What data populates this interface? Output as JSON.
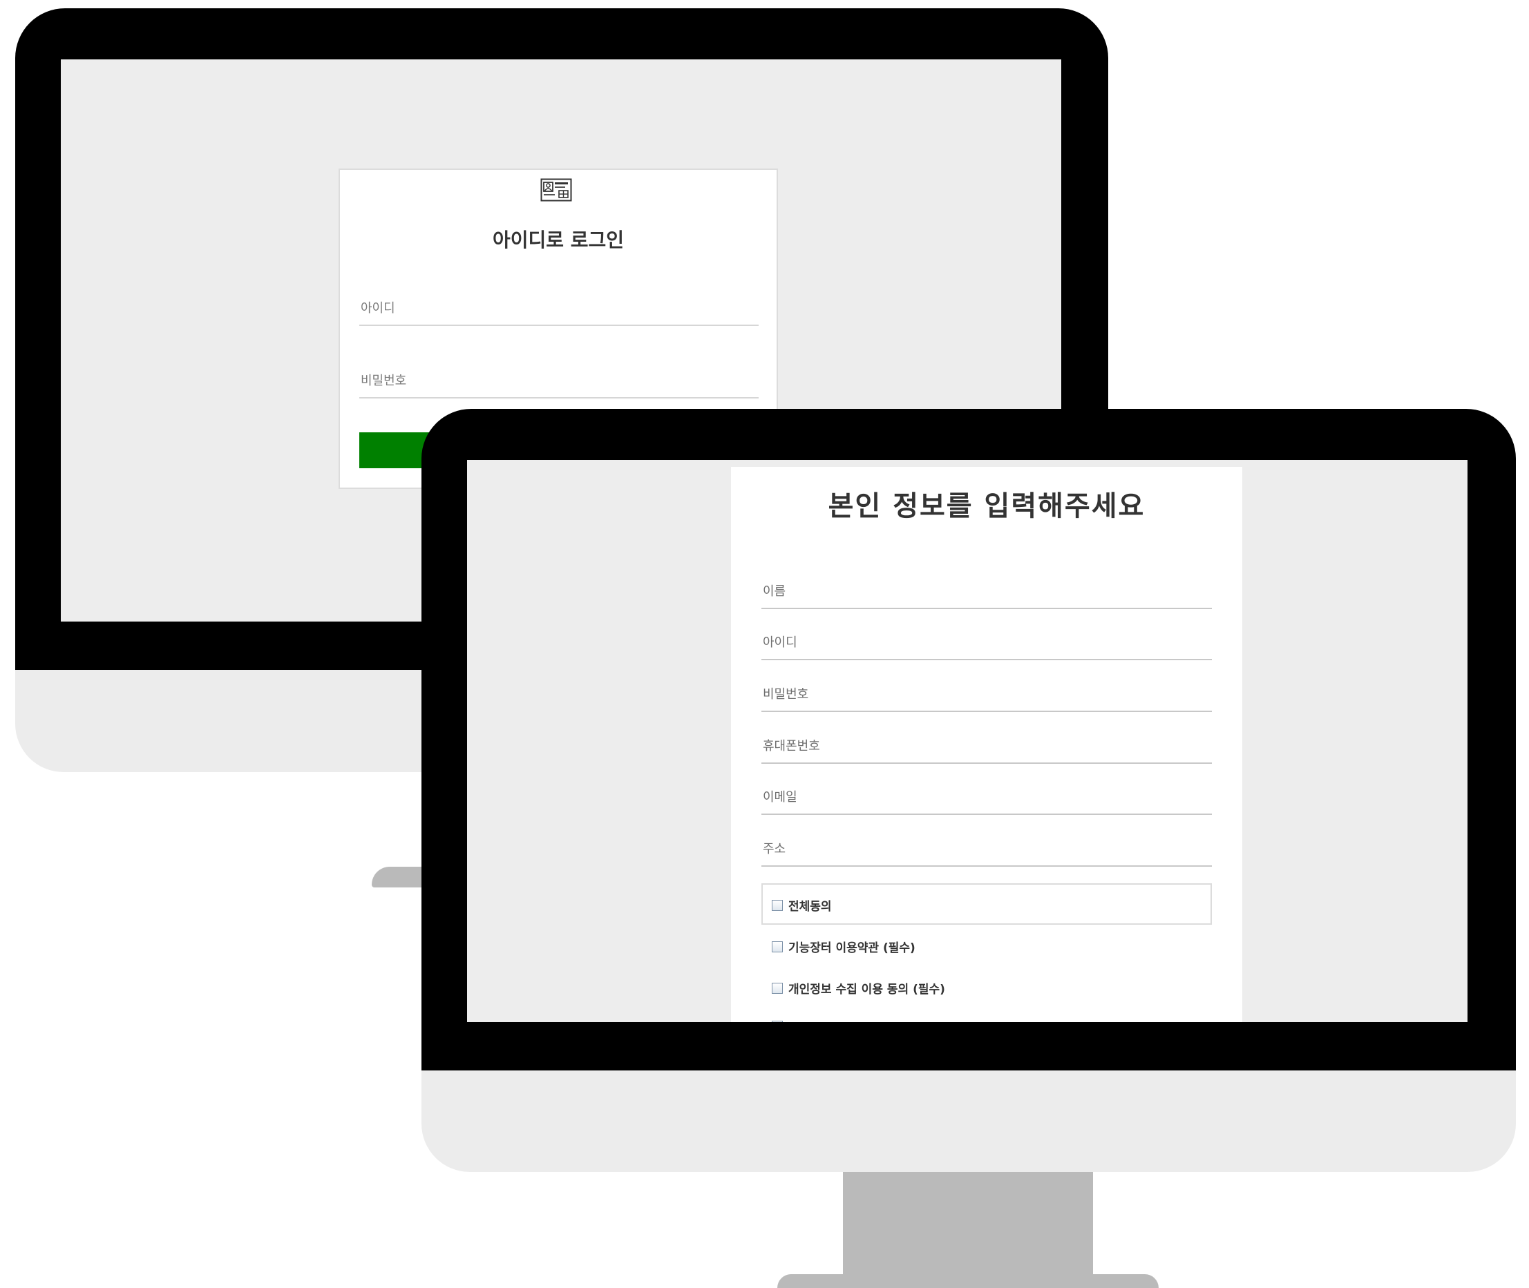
{
  "login_screen": {
    "icon": "id-card-icon",
    "title": "아이디로 로그인",
    "id_placeholder": "아이디",
    "password_placeholder": "비밀번호",
    "button_color": "#008000"
  },
  "signup_screen": {
    "title": "본인 정보를 입력해주세요",
    "fields": [
      {
        "placeholder": "이름"
      },
      {
        "placeholder": "아이디"
      },
      {
        "placeholder": "비밀번호"
      },
      {
        "placeholder": "휴대폰번호"
      },
      {
        "placeholder": "이메일"
      },
      {
        "placeholder": "주소"
      }
    ],
    "agreements": {
      "all": "전체동의",
      "terms": "기능장터 이용약관 (필수)",
      "privacy": "개인정보 수집 이용 동의 (필수)"
    }
  }
}
